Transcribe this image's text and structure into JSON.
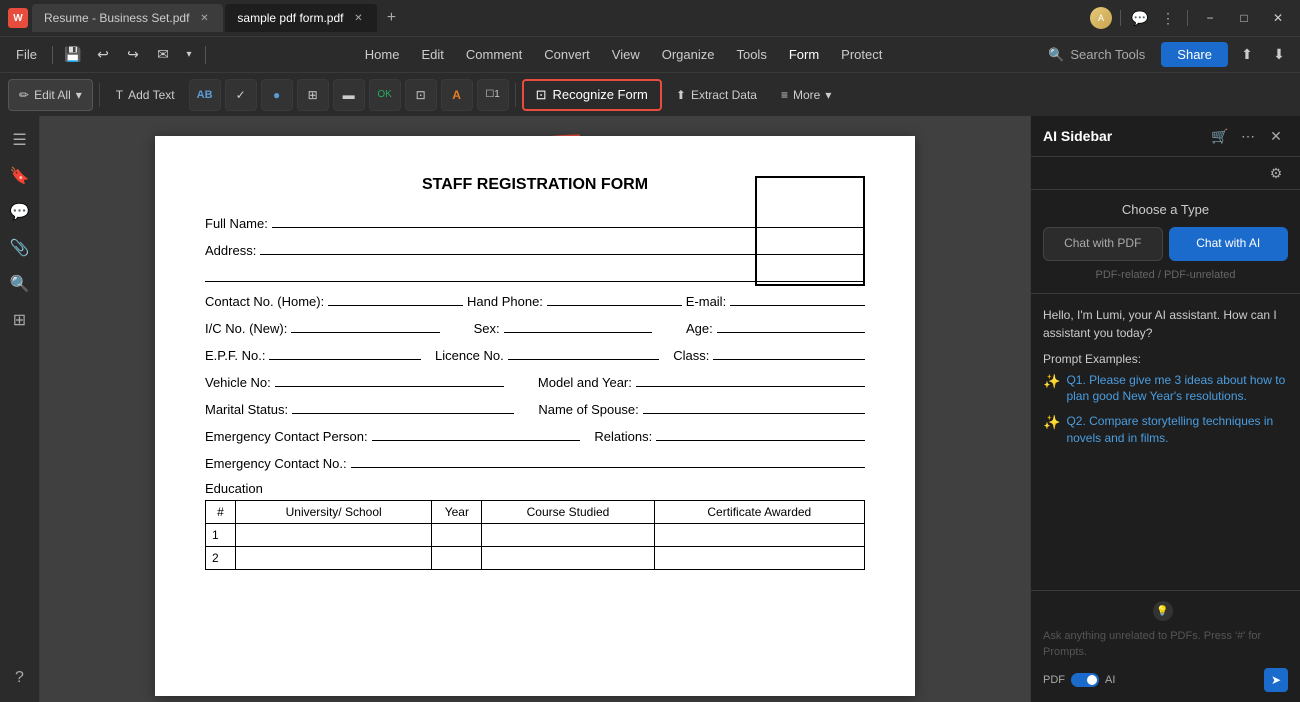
{
  "titlebar": {
    "app_icon": "W",
    "tabs": [
      {
        "label": "Resume - Business Set.pdf",
        "active": false
      },
      {
        "label": "sample pdf form.pdf",
        "active": true
      }
    ],
    "new_tab": "+",
    "avatar_initials": "A",
    "controls": [
      "−",
      "□",
      "×"
    ]
  },
  "menubar": {
    "file": "File",
    "actions": [
      "undo",
      "redo",
      "email",
      "dropdown"
    ],
    "items": [
      "Home",
      "Edit",
      "Comment",
      "Convert",
      "View",
      "Organize",
      "Tools",
      "Form",
      "Protect"
    ],
    "active_item": "Form",
    "search_tools": "Search Tools",
    "share": "Share"
  },
  "toolbar": {
    "edit_all": "Edit All",
    "add_text": "Add Text",
    "tools": [
      "AB",
      "✓",
      "●",
      "▦",
      "▬",
      "OK",
      "⊡",
      "A",
      "☐"
    ],
    "recognize_form": "Recognize Form",
    "extract_data": "Extract Data",
    "more": "More"
  },
  "left_sidebar": {
    "icons": [
      "☰",
      "🔖",
      "💬",
      "📎",
      "🔍",
      "⊞",
      "?"
    ]
  },
  "pdf": {
    "title": "STAFF REGISTRATION FORM",
    "fields": {
      "full_name": "Full Name:",
      "address": "Address:",
      "contact_home": "Contact No. (Home):",
      "hand_phone": "Hand Phone:",
      "email": "E-mail:",
      "ic_no": "I/C No. (New):",
      "sex": "Sex:",
      "age": "Age:",
      "epf_no": "E.P.F. No.:",
      "licence_no": "Licence No.",
      "class": "Class:",
      "vehicle_no": "Vehicle No:",
      "model_year": "Model and Year:",
      "marital_status": "Marital Status:",
      "spouse": "Name of Spouse:",
      "emergency_contact": "Emergency Contact Person:",
      "relations": "Relations:",
      "emergency_no": "Emergency Contact No.:",
      "education": "Education"
    },
    "table": {
      "headers": [
        "#",
        "University/ School",
        "Year",
        "Course Studied",
        "Certificate Awarded"
      ],
      "rows": [
        [
          "1",
          "",
          "",
          "",
          ""
        ],
        [
          "2",
          "",
          "",
          "",
          ""
        ]
      ]
    }
  },
  "ai_sidebar": {
    "title": "AI Sidebar",
    "type_title": "Choose a Type",
    "btn_chat_pdf": "Chat with PDF",
    "btn_chat_ai": "Chat with AI",
    "subtitle": "PDF-related / PDF-unrelated",
    "greeting": "Hello, I'm Lumi, your AI assistant. How can I assistant you today?",
    "prompt_title": "Prompt Examples:",
    "prompts": [
      "Q1. Please give me 3 ideas about how to plan good New Year's resolutions.",
      "Q2. Compare storytelling techniques in novels and in films."
    ],
    "input_hint": "Ask anything unrelated to PDFs. Press '#' for Prompts.",
    "toggle_labels": [
      "PDF",
      "AI"
    ]
  }
}
